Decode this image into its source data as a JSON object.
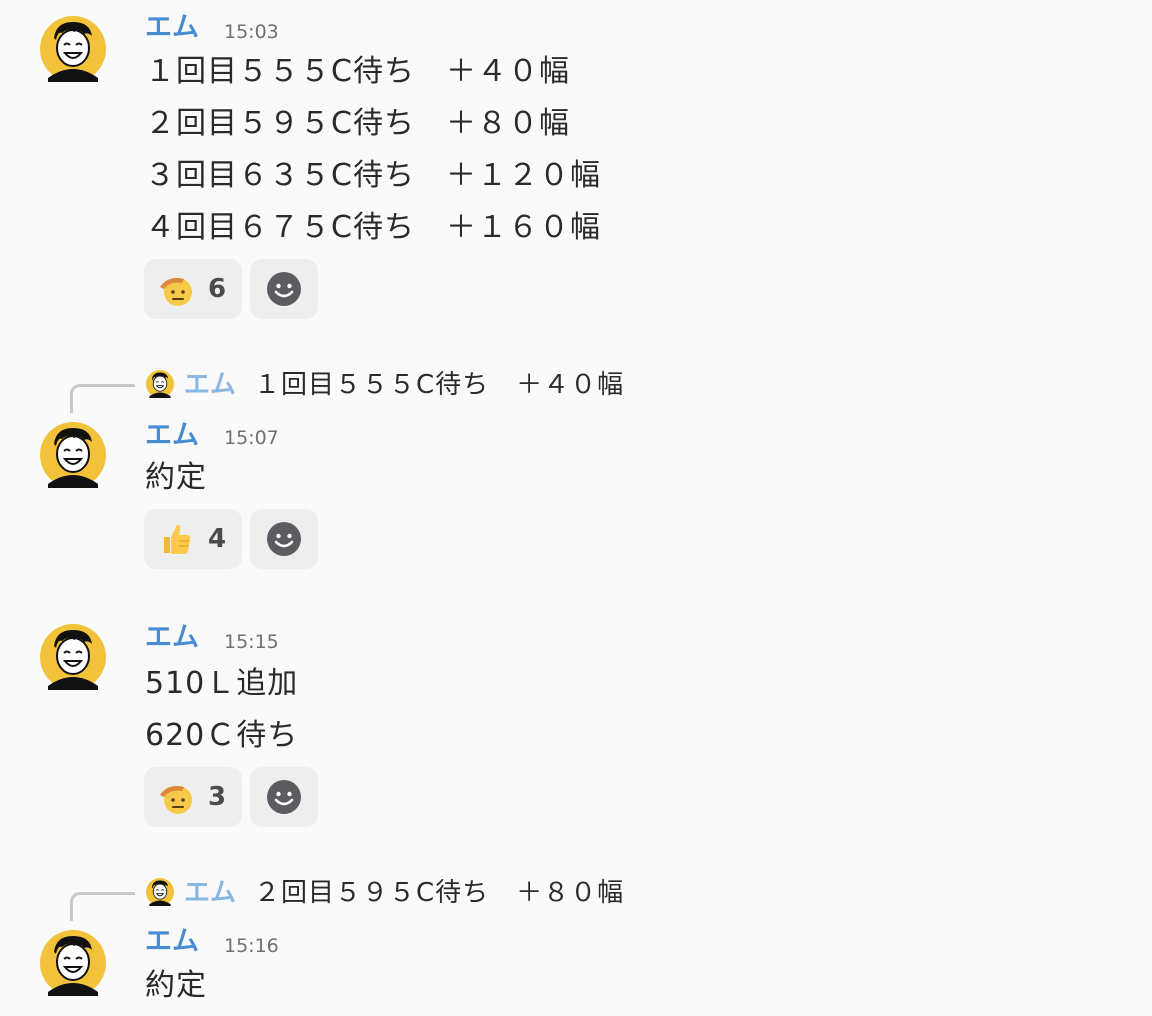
{
  "messages": [
    {
      "author": "エム",
      "time": "15:03",
      "lines": [
        "１回目５５５C待ち　＋４０幅",
        "２回目５９５C待ち　＋８０幅",
        "３回目６３５C待ち　＋１２０幅",
        "４回目６７５C待ち　＋１６０幅"
      ],
      "reaction": {
        "icon": "saluting-face-icon",
        "count": "6"
      }
    },
    {
      "reply_to": {
        "author": "エム",
        "text": "１回目５５５C待ち　＋４０幅"
      },
      "author": "エム",
      "time": "15:07",
      "lines": [
        "約定"
      ],
      "reaction": {
        "icon": "thumbs-up-icon",
        "count": "4"
      }
    },
    {
      "author": "エム",
      "time": "15:15",
      "lines": [
        "510Ｌ追加",
        "620Ｃ待ち"
      ],
      "reaction": {
        "icon": "saluting-face-icon",
        "count": "3"
      }
    },
    {
      "reply_to": {
        "author": "エム",
        "text": "２回目５９５C待ち　＋８０幅"
      },
      "author": "エム",
      "time": "15:16",
      "lines": [
        "約定"
      ]
    }
  ],
  "colors": {
    "author": "#4a8cd4",
    "reply_author": "#8ab8e3",
    "avatar_bg": "#f2c23a",
    "reaction_bg": "#eeeeee"
  }
}
